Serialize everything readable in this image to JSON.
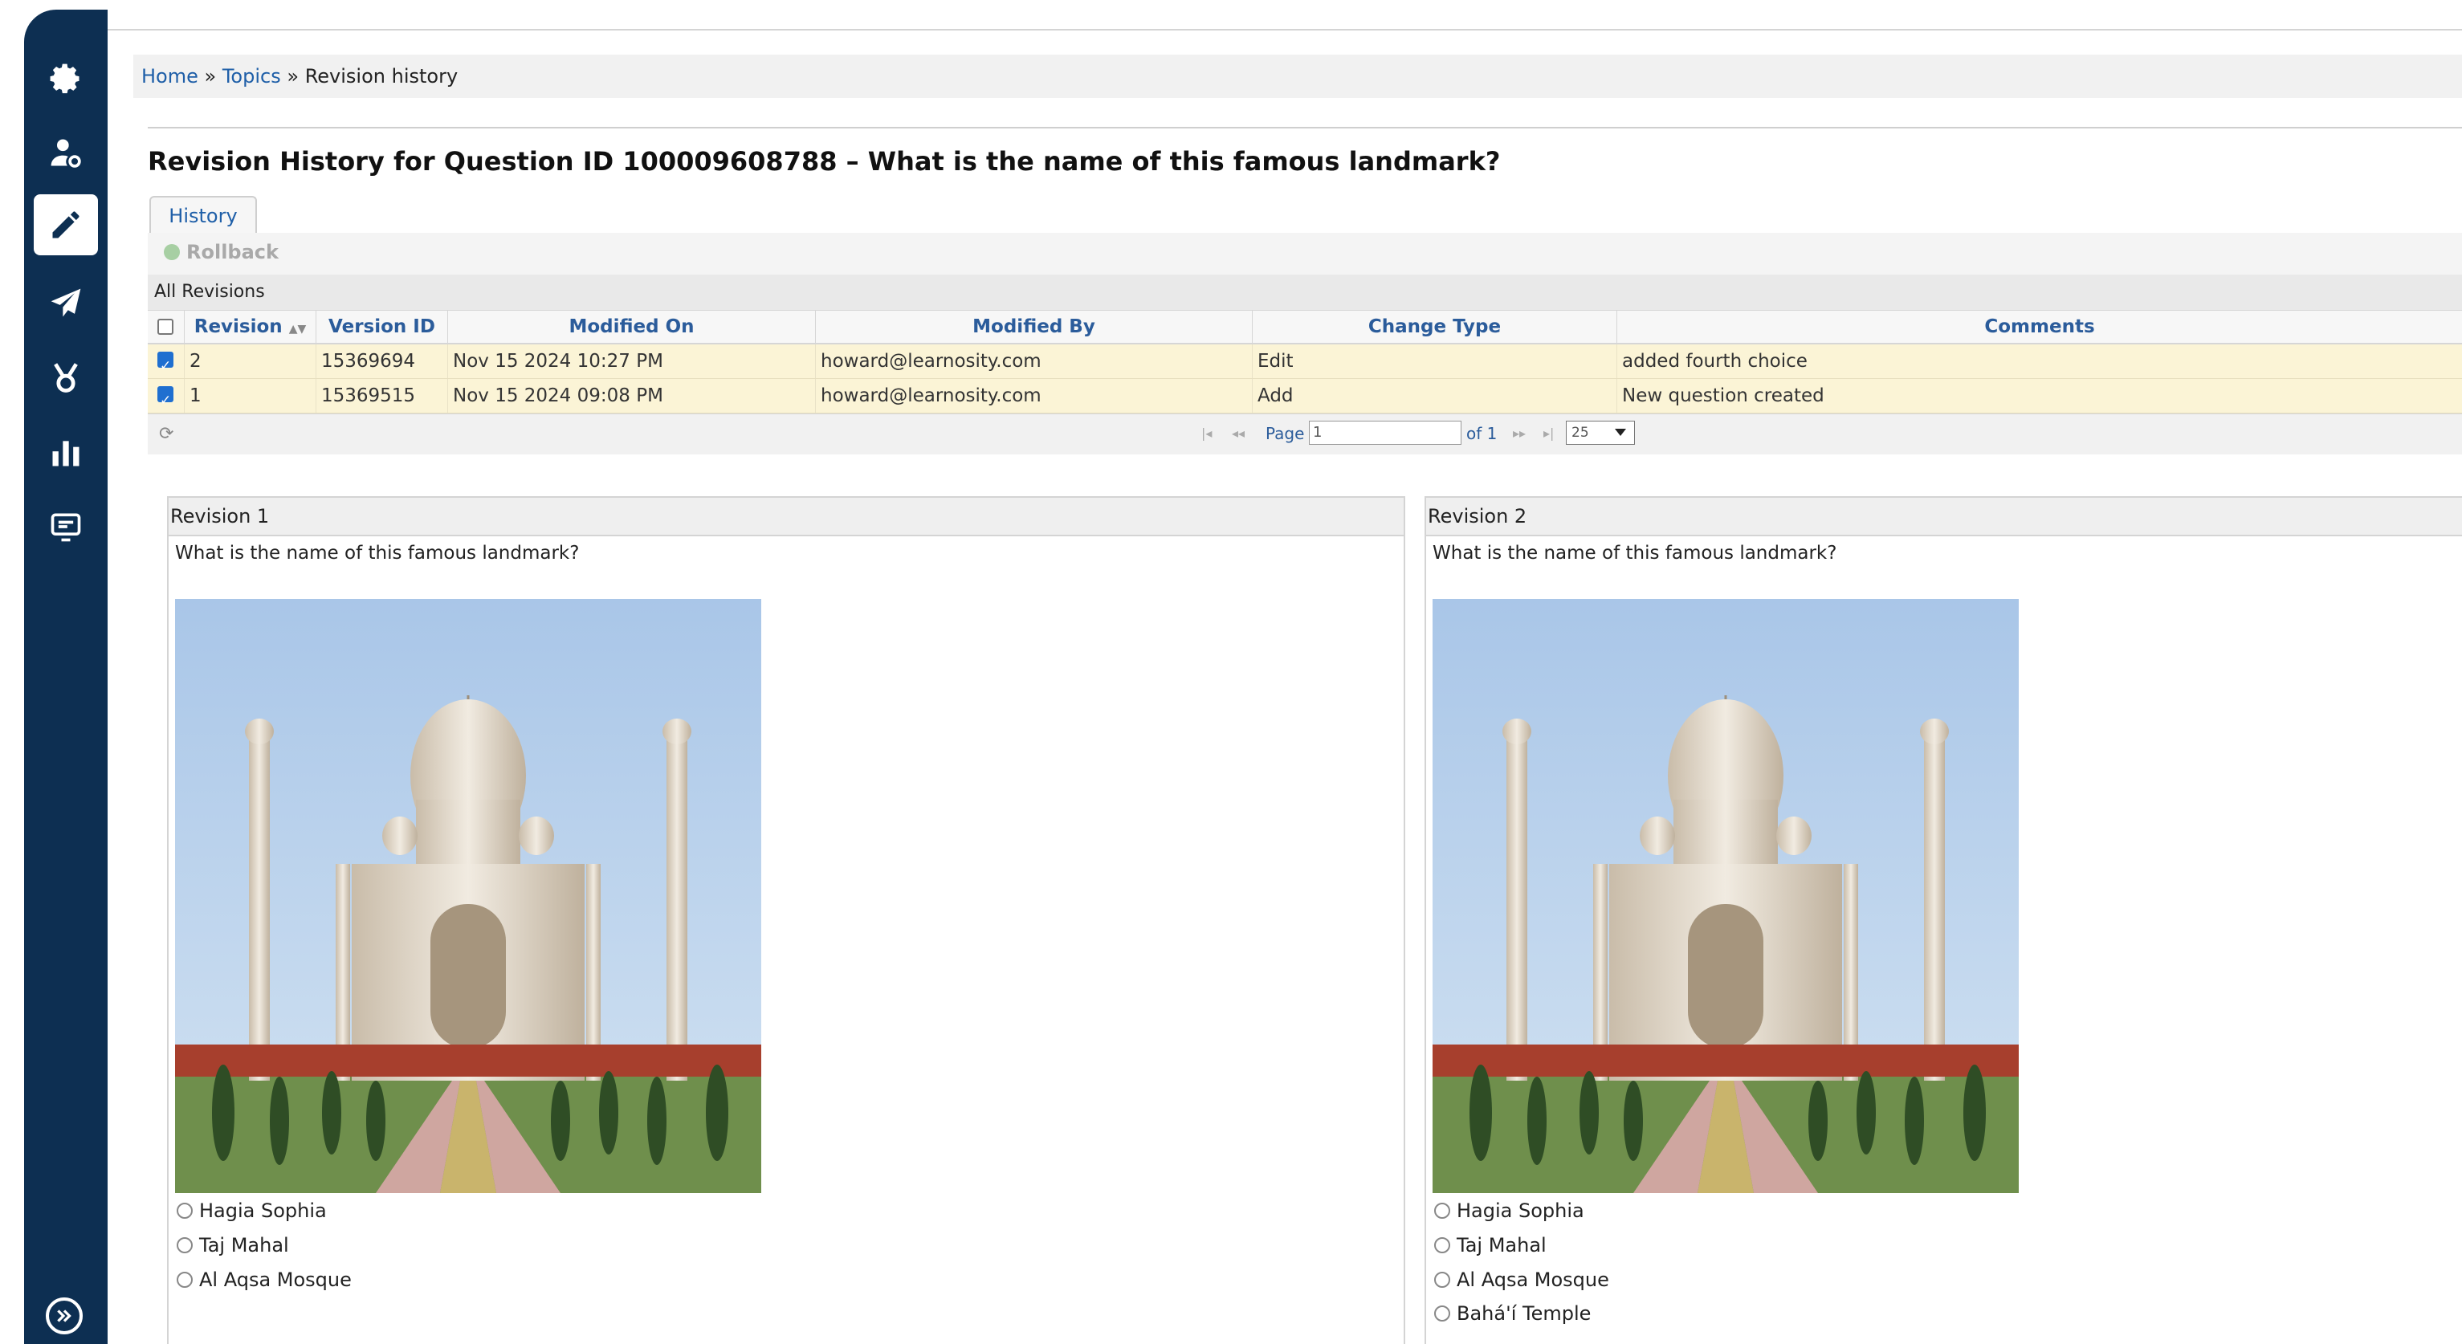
{
  "sidebar": {
    "items": [
      {
        "icon": "gear-icon"
      },
      {
        "icon": "user-settings-icon"
      },
      {
        "icon": "pencil-icon",
        "active": true
      },
      {
        "icon": "paper-plane-icon"
      },
      {
        "icon": "badge-icon"
      },
      {
        "icon": "bar-chart-icon"
      },
      {
        "icon": "monitor-icon"
      }
    ],
    "expand_icon": "double-chevron-right-icon",
    "colors": {
      "background": "#0d2f52",
      "active": "#ffffff"
    }
  },
  "breadcrumb": {
    "home": "Home",
    "sep1": "»",
    "topics": "Topics",
    "sep2": "»",
    "current": "Revision history"
  },
  "page_title": "Revision History for Question ID 100009608788 – What is the name of this famous landmark?",
  "tabs": {
    "history": "History"
  },
  "toolbar": {
    "rollback": "Rollback"
  },
  "grid": {
    "caption": "All Revisions",
    "columns": [
      "Revision",
      "Version ID",
      "Modified On",
      "Modified By",
      "Change Type",
      "Comments"
    ],
    "sort_icon": "sort-arrows-icon",
    "rows": [
      {
        "checked": true,
        "revision": "2",
        "version_id": "15369694",
        "modified_on": "Nov 15 2024 10:27 PM",
        "modified_by": "howard@learnosity.com",
        "change_type": "Edit",
        "comments": "added fourth choice"
      },
      {
        "checked": true,
        "revision": "1",
        "version_id": "15369515",
        "modified_on": "Nov 15 2024 09:08 PM",
        "modified_by": "howard@learnosity.com",
        "change_type": "Add",
        "comments": "New question created"
      }
    ],
    "pager": {
      "page_label": "Page",
      "page_value": "1",
      "of_label": "of 1",
      "page_size": "25"
    },
    "colors": {
      "row_highlight": "#fbf4d6",
      "header_text": "#2b5c9b"
    }
  },
  "revisions": [
    {
      "title": "Revision 1",
      "question": "What is the name of this famous landmark?",
      "image": "taj-mahal-photo",
      "options": [
        "Hagia Sophia",
        "Taj Mahal",
        "Al Aqsa Mosque"
      ]
    },
    {
      "title": "Revision 2",
      "question": "What is the name of this famous landmark?",
      "image": "taj-mahal-photo",
      "options": [
        "Hagia Sophia",
        "Taj Mahal",
        "Al Aqsa Mosque",
        "Bahá'í Temple"
      ]
    }
  ]
}
